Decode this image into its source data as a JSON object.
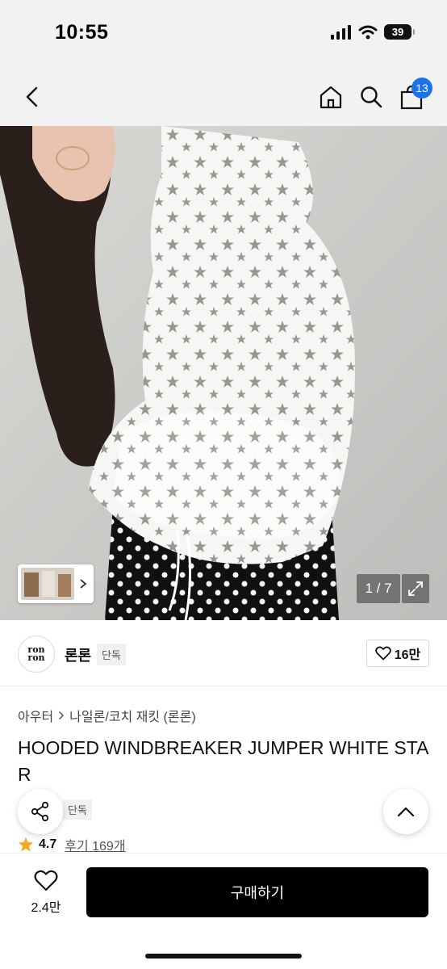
{
  "status": {
    "time": "10:55",
    "battery": "39"
  },
  "header": {
    "cart_count": "13"
  },
  "gallery": {
    "page": "1 / 7"
  },
  "brand": {
    "logo_line1": "ron",
    "logo_line2": "ron",
    "name": "론론",
    "tag": "단독",
    "likes": "16만"
  },
  "product": {
    "breadcrumb": [
      "아우터",
      "나일론/코치 재킷 (론론)"
    ],
    "title": "HOODED WINDBREAKER JUMPER WHITE STAR",
    "exclusive_tag": "단독",
    "rating": "4.7",
    "reviews": "후기 169개"
  },
  "bottom": {
    "wish_count": "2.4만",
    "buy_label": "구매하기"
  },
  "colors": {
    "accent": "#1a73e8",
    "star": "#f5a623",
    "buy": "#000000"
  }
}
